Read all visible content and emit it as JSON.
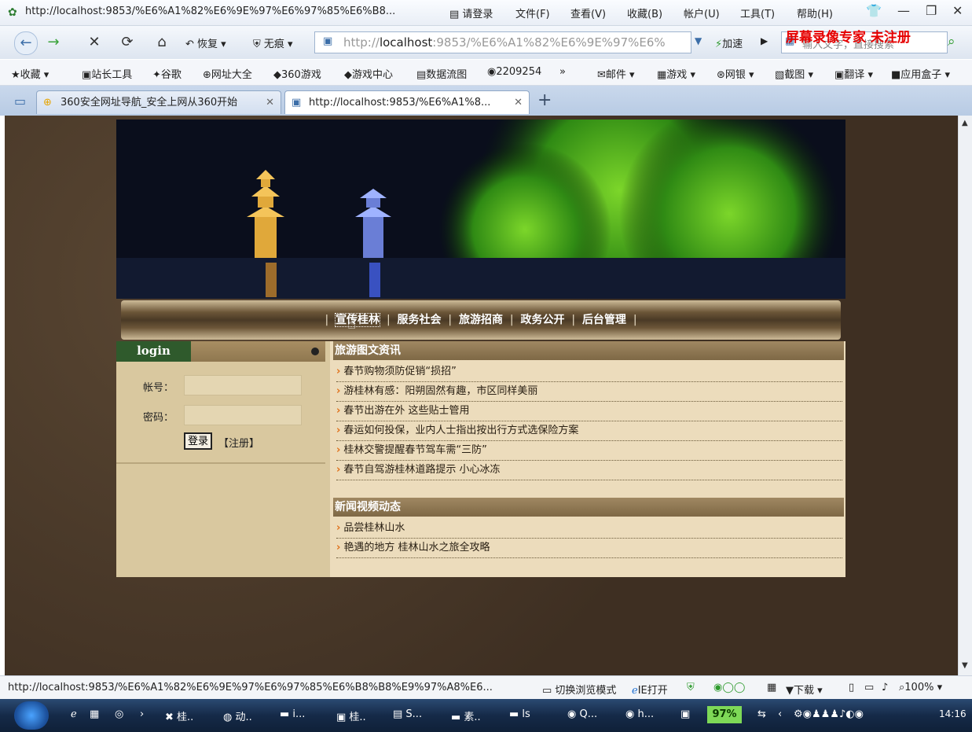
{
  "titlebar": {
    "url": "http://localhost:9853/%E6%A1%82%E6%9E%97%E6%97%85%E6%B8...",
    "login": "请登录",
    "menus": [
      "文件(F)",
      "查看(V)",
      "收藏(B)",
      "帐户(U)",
      "工具(T)",
      "帮助(H)"
    ]
  },
  "navbar": {
    "restore": "恢复",
    "noTrace": "无痕",
    "address_host": "http://",
    "address_bold": "localhost",
    "address_rest": ":9853/%E6%A1%82%E6%9E%97%E6%",
    "accelerate": "加速",
    "search_placeholder": "输入文字，直接搜索",
    "watermark": "屏幕录像专家 未注册"
  },
  "favorites": [
    "收藏",
    "站长工具",
    "谷歌",
    "网址大全",
    "360游戏",
    "游戏中心",
    "数据流图",
    "2209254",
    "»",
    "邮件",
    "游戏",
    "网银",
    "截图",
    "翻译",
    "应用盒子"
  ],
  "tabs": [
    {
      "label": "360安全网址导航_安全上网从360开始"
    },
    {
      "label": "http://localhost:9853/%E6%A1%8..."
    }
  ],
  "site": {
    "menu": [
      "宣传桂林",
      "服务社会",
      "旅游招商",
      "政务公开",
      "后台管理"
    ],
    "login": {
      "title": "login",
      "account_label": "帐号：",
      "password_label": "密码：",
      "submit": "登录",
      "register": "【注册】"
    },
    "section1": {
      "title": "旅游图文资讯",
      "items": [
        "春节购物须防促销“损招”",
        "游桂林有感：阳朔固然有趣，市区同样美丽",
        "春节出游在外 这些贴士管用",
        "春运如何投保，业内人士指出按出行方式选保险方案",
        "桂林交警提醒春节驾车需“三防”",
        "春节自驾游桂林道路提示 小心冰冻"
      ]
    },
    "section2": {
      "title": "新闻视频动态",
      "items": [
        "品尝桂林山水",
        "艳遇的地方 桂林山水之旅全攻略"
      ]
    }
  },
  "statusbar": {
    "url": "http://localhost:9853/%E6%A1%82%E6%9E%97%E6%97%85%E6%B8%B8%E9%97%A8%E6...",
    "switch_mode": "切换浏览模式",
    "ie_open": "IE打开",
    "download": "下载",
    "zoom": "100%"
  },
  "taskbar": {
    "tasks": [
      "桂..",
      "动..",
      "i...",
      "桂..",
      "S...",
      "素..",
      "ls",
      "Q...",
      "h..."
    ],
    "battery": "97%",
    "time": "14:16"
  }
}
